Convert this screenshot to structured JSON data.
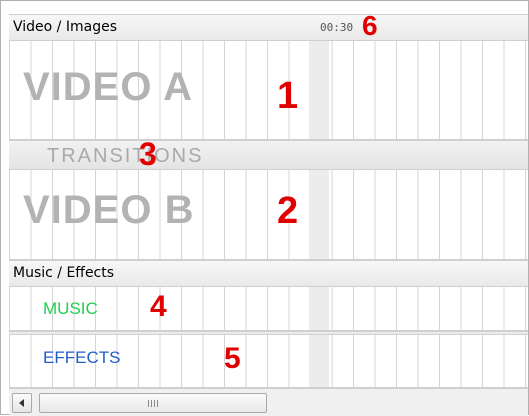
{
  "section_video": {
    "title": "Video / Images",
    "time": "00:30",
    "marker": "6"
  },
  "tracks": {
    "video_a": {
      "label": "VIDEO A",
      "marker": "1"
    },
    "transitions": {
      "label": "TRANSITIONS",
      "marker": "3"
    },
    "video_b": {
      "label": "VIDEO B",
      "marker": "2"
    }
  },
  "section_music": {
    "title": "Music / Effects"
  },
  "audio": {
    "music": {
      "label": "MUSIC",
      "marker": "4",
      "color": "#1fcf4f"
    },
    "effects": {
      "label": "EFFECTS",
      "marker": "5",
      "color": "#1f5fc8"
    }
  },
  "colors": {
    "marker": "#e10000",
    "track_label": "#b3b3b3"
  },
  "scrollbar": {
    "left_icon": "left-arrow-icon",
    "grip_icon": "grip-icon"
  }
}
